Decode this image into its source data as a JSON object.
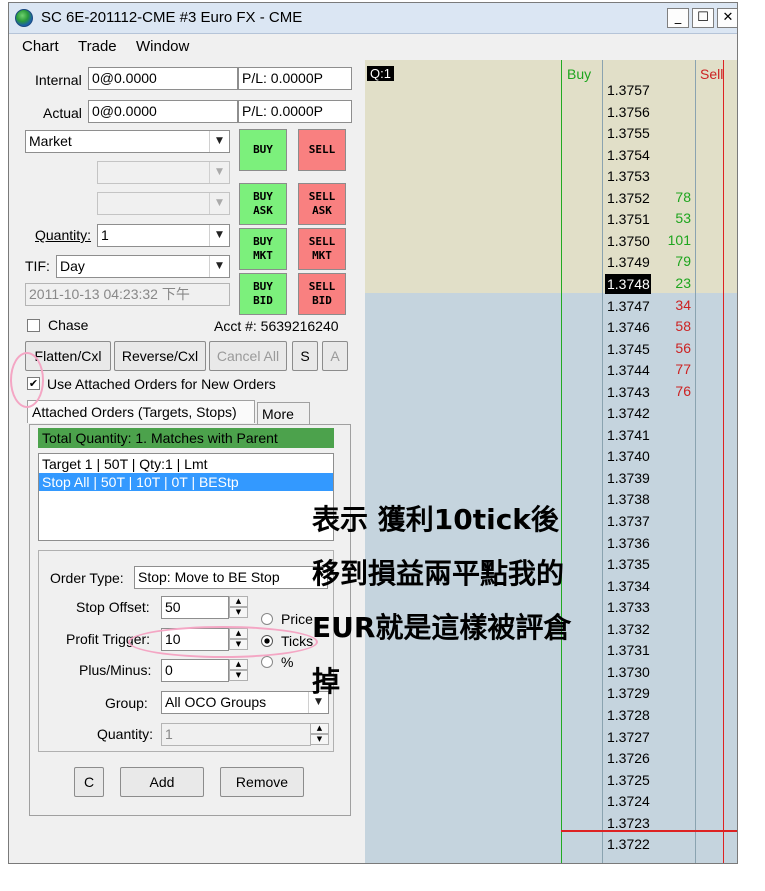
{
  "window": {
    "title": "SC 6E-201112-CME  #3  Euro FX - CME",
    "min": "_",
    "max": "☐",
    "close": "✕"
  },
  "menu": [
    "Chart",
    "Trade",
    "Window"
  ],
  "trade": {
    "internal_label": "Internal",
    "internal_value": "0@0.0000",
    "internal_pl": "P/L: 0.0000P",
    "actual_label": "Actual",
    "actual_value": "0@0.0000",
    "actual_pl": "P/L: 0.0000P",
    "order_type": "Market",
    "quantity_label": "Quantity:",
    "quantity_value": "1",
    "tif_label": "TIF:",
    "tif_value": "Day",
    "datetime": "2011-10-13 04:23:32 下午",
    "chase_label": "Chase",
    "acct": "Acct #: 5639216240",
    "buttons": {
      "buy": "BUY",
      "sell": "SELL",
      "buy_ask_1": "BUY",
      "buy_ask_2": "ASK",
      "sell_ask_1": "SELL",
      "sell_ask_2": "ASK",
      "buy_mkt_1": "BUY",
      "buy_mkt_2": "MKT",
      "sell_mkt_1": "SELL",
      "sell_mkt_2": "MKT",
      "buy_bid_1": "BUY",
      "buy_bid_2": "BID",
      "sell_bid_1": "SELL",
      "sell_bid_2": "BID"
    },
    "flatten": "Flatten/Cxl",
    "reverse": "Reverse/Cxl",
    "cancel_all": "Cancel All",
    "s": "S",
    "a": "A",
    "use_attached": "Use Attached Orders for New Orders"
  },
  "tabs": {
    "attached": "Attached Orders (Targets, Stops)",
    "more": "More"
  },
  "attached": {
    "header": "Total Quantity: 1. Matches with Parent",
    "list": [
      "Target 1 | 50T | Qty:1 | Lmt",
      "Stop All | 50T | 10T | 0T | BEStp"
    ],
    "order_type_label": "Order Type:",
    "order_type_value": "Stop: Move to BE Stop",
    "stop_offset_label": "Stop Offset:",
    "stop_offset_value": "50",
    "profit_trigger_label": "Profit Trigger:",
    "profit_trigger_value": "10",
    "plus_minus_label": "Plus/Minus:",
    "plus_minus_value": "0",
    "radio_price": "Price",
    "radio_ticks": "Ticks",
    "radio_pct": "%",
    "group_label": "Group:",
    "group_value": "All OCO Groups",
    "quantity_label": "Quantity:",
    "quantity_value": "1",
    "btn_c": "C",
    "btn_add": "Add",
    "btn_remove": "Remove"
  },
  "ladder": {
    "q_label": "Q:1",
    "buy_header": "Buy",
    "sell_header": "Sell",
    "prices": [
      "1.3757",
      "1.3756",
      "1.3755",
      "1.3754",
      "1.3753",
      "1.3752",
      "1.3751",
      "1.3750",
      "1.3749",
      "1.3748",
      "1.3747",
      "1.3746",
      "1.3745",
      "1.3744",
      "1.3743",
      "1.3742",
      "1.3741",
      "1.3740",
      "1.3739",
      "1.3738",
      "1.3737",
      "1.3736",
      "1.3735",
      "1.3734",
      "1.3733",
      "1.3732",
      "1.3731",
      "1.3730",
      "1.3729",
      "1.3728",
      "1.3727",
      "1.3726",
      "1.3725",
      "1.3724",
      "1.3723",
      "1.3722"
    ],
    "volumes": [
      "",
      "",
      "",
      "",
      "",
      "78",
      "53",
      "101",
      "79",
      "23",
      "34",
      "58",
      "56",
      "77",
      "76",
      "",
      "",
      "",
      "",
      "",
      "",
      "",
      "",
      "",
      "",
      "",
      "",
      "",
      "",
      "",
      "",
      "",
      "",
      "",
      "",
      ""
    ],
    "current_index": 9,
    "colors": {
      "ask_green": "#1ea51e",
      "bid_red": "#cc2222",
      "buy_line": "#22aa22",
      "sell_line": "#dd2222"
    }
  },
  "annotation": [
    "表示 獲利10tick後",
    "移到損益兩平點我的",
    "EUR就是這樣被評倉",
    "掉"
  ]
}
